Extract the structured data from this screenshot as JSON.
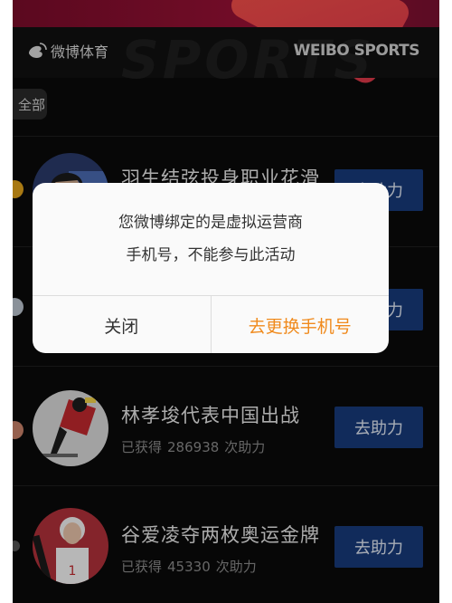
{
  "header": {
    "logo_text": "微博体育",
    "brand_right": "WEIBO SPORTS",
    "watermark": "SPORTS"
  },
  "filter": {
    "label": "全部"
  },
  "rows": [
    {
      "title": "羽生结弦投身职业花滑",
      "button": "去助力"
    },
    {
      "title": "",
      "button": "去助力"
    },
    {
      "title": "林孝埈代表中国出战",
      "sub_prefix": "已获得",
      "count": "286938",
      "sub_suffix": "次助力",
      "button": "去助力"
    },
    {
      "title": "谷爱凌夺两枚奥运金牌",
      "sub_prefix": "已获得",
      "count": "45330",
      "sub_suffix": "次助力",
      "button": "去助力"
    }
  ],
  "dialog": {
    "message_line1": "您微博绑定的是虚拟运营商",
    "message_line2": "手机号，不能参与此活动",
    "close_label": "关闭",
    "change_label": "去更换手机号"
  },
  "colors": {
    "background": "#0a0a0a",
    "button": "#173a7a",
    "accent_orange": "#f08a1c",
    "banner": "#9b1236"
  }
}
